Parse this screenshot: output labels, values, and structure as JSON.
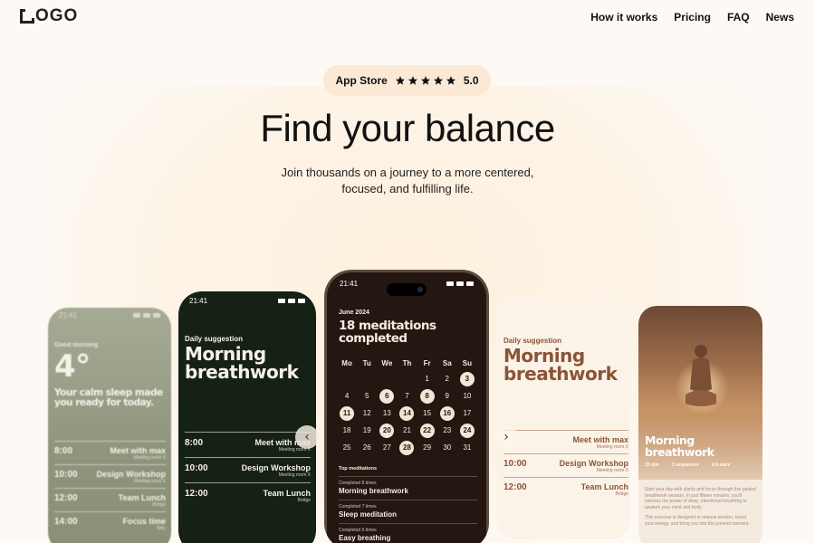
{
  "nav": {
    "logo": "OGO",
    "links": [
      "How it works",
      "Pricing",
      "FAQ",
      "News"
    ]
  },
  "hero": {
    "badge_store": "App Store",
    "rating": "5.0",
    "stars": 5,
    "title": "Find your balance",
    "subtitle_line1": "Join thousands on a journey to a more centered,",
    "subtitle_line2": "focused, and fulfilling life."
  },
  "phone_weather": {
    "time": "21:41",
    "greeting": "Good morning",
    "temp": "4°",
    "message": "Your calm sleep made you ready for today.",
    "events": [
      {
        "time": "8:00",
        "name": "Meet with max",
        "loc": "Meeting room X"
      },
      {
        "time": "10:00",
        "name": "Design Workshop",
        "loc": "Meeting room X"
      },
      {
        "time": "12:00",
        "name": "Team Lunch",
        "loc": "Bridge"
      },
      {
        "time": "14:00",
        "name": "Focus time",
        "loc": "Nitty"
      }
    ]
  },
  "phone_dark_green": {
    "time": "21:41",
    "label": "Daily suggestion",
    "title_line1": "Morning",
    "title_line2": "breathwork",
    "events": [
      {
        "time": "8:00",
        "name": "Meet with max",
        "loc": "Meeting room X"
      },
      {
        "time": "10:00",
        "name": "Design Workshop",
        "loc": "Meeting room X"
      },
      {
        "time": "12:00",
        "name": "Team Lunch",
        "loc": "Bridge"
      }
    ]
  },
  "phone_calendar": {
    "time": "21:41",
    "month": "June 2024",
    "headline_line1": "18 meditations",
    "headline_line2": "completed",
    "weekdays": [
      "Mo",
      "Tu",
      "We",
      "Th",
      "Fr",
      "Sa",
      "Su"
    ],
    "days": [
      {
        "d": "",
        "hl": false
      },
      {
        "d": "",
        "hl": false
      },
      {
        "d": "",
        "hl": false
      },
      {
        "d": "",
        "hl": false
      },
      {
        "d": "1",
        "hl": false
      },
      {
        "d": "2",
        "hl": false
      },
      {
        "d": "3",
        "hl": true
      },
      {
        "d": "4",
        "hl": false
      },
      {
        "d": "5",
        "hl": false
      },
      {
        "d": "6",
        "hl": true
      },
      {
        "d": "7",
        "hl": false
      },
      {
        "d": "8",
        "hl": true
      },
      {
        "d": "9",
        "hl": false
      },
      {
        "d": "10",
        "hl": false
      },
      {
        "d": "11",
        "hl": true
      },
      {
        "d": "12",
        "hl": false
      },
      {
        "d": "13",
        "hl": false
      },
      {
        "d": "14",
        "hl": true
      },
      {
        "d": "15",
        "hl": false
      },
      {
        "d": "16",
        "hl": true
      },
      {
        "d": "17",
        "hl": false
      },
      {
        "d": "18",
        "hl": false
      },
      {
        "d": "19",
        "hl": false
      },
      {
        "d": "20",
        "hl": true
      },
      {
        "d": "21",
        "hl": false
      },
      {
        "d": "22",
        "hl": true
      },
      {
        "d": "23",
        "hl": false
      },
      {
        "d": "24",
        "hl": true
      },
      {
        "d": "25",
        "hl": false
      },
      {
        "d": "26",
        "hl": false
      },
      {
        "d": "27",
        "hl": false
      },
      {
        "d": "28",
        "hl": true
      },
      {
        "d": "29",
        "hl": false
      },
      {
        "d": "30",
        "hl": false
      },
      {
        "d": "31",
        "hl": false
      }
    ],
    "top_label": "Top meditations",
    "meditations": [
      {
        "count": "Completed 8 times",
        "name": "Morning breathwork"
      },
      {
        "count": "Completed 7 times",
        "name": "Sleep meditation"
      },
      {
        "count": "Completed 5 times",
        "name": "Easy breathing"
      }
    ]
  },
  "phone_light": {
    "label": "Daily suggestion",
    "title_line1": "Morning",
    "title_line2": "breathwork",
    "events": [
      {
        "time": "",
        "name": "Meet with max",
        "loc": "Meeting room X"
      },
      {
        "time": "10:00",
        "name": "Design Workshop",
        "loc": "Meeting room X"
      },
      {
        "time": "12:00",
        "name": "Team Lunch",
        "loc": "Bridge"
      }
    ]
  },
  "phone_image": {
    "title_line1": "Morning",
    "title_line2": "breathwork",
    "stats": [
      "15 min",
      "3 sequences",
      "4.9 stars"
    ],
    "para1": "Start your day with clarity and focus through this guided breathwork session. In just fifteen minutes, you'll harness the power of deep, intentional breathing to awaken your mind and body.",
    "para2": "This exercise is designed to release tension, boost your energy, and bring you into the present moment."
  },
  "carousel": {
    "prev": "‹",
    "next": "›"
  },
  "colors": {
    "badge_bg": "#fbe9d5",
    "dark_green": "#162116",
    "dark_brown": "#241712",
    "accent_brown": "#8b5436"
  }
}
